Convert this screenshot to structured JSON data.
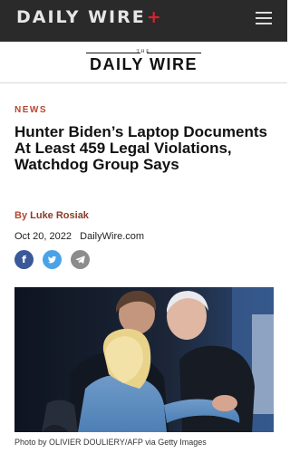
{
  "topbar": {
    "brand": "DAILY WIRE",
    "plus": "+",
    "menu_icon": "hamburger-menu-icon"
  },
  "masthead": {
    "the": "THE",
    "name": "DAILY WIRE"
  },
  "article": {
    "category": "NEWS",
    "title": "Hunter Biden’s Laptop Documents At Least 459 Legal Violations, Watchdog Group Says",
    "byline_prefix": "By",
    "author": "Luke Rosiak",
    "date": "Oct 20, 2022",
    "source": "DailyWire.com",
    "share_icons": [
      "facebook-icon",
      "twitter-icon",
      "telegram-icon"
    ],
    "photo_caption": "Photo by OLIVIER DOULIERY/AFP via Getty Images"
  },
  "colors": {
    "topbar_bg": "#2a2a2a",
    "brand_plus": "#d62330",
    "accent": "#b5462f",
    "facebook": "#3b5998",
    "twitter": "#4aa3e8",
    "telegram": "#8c8c8c"
  }
}
